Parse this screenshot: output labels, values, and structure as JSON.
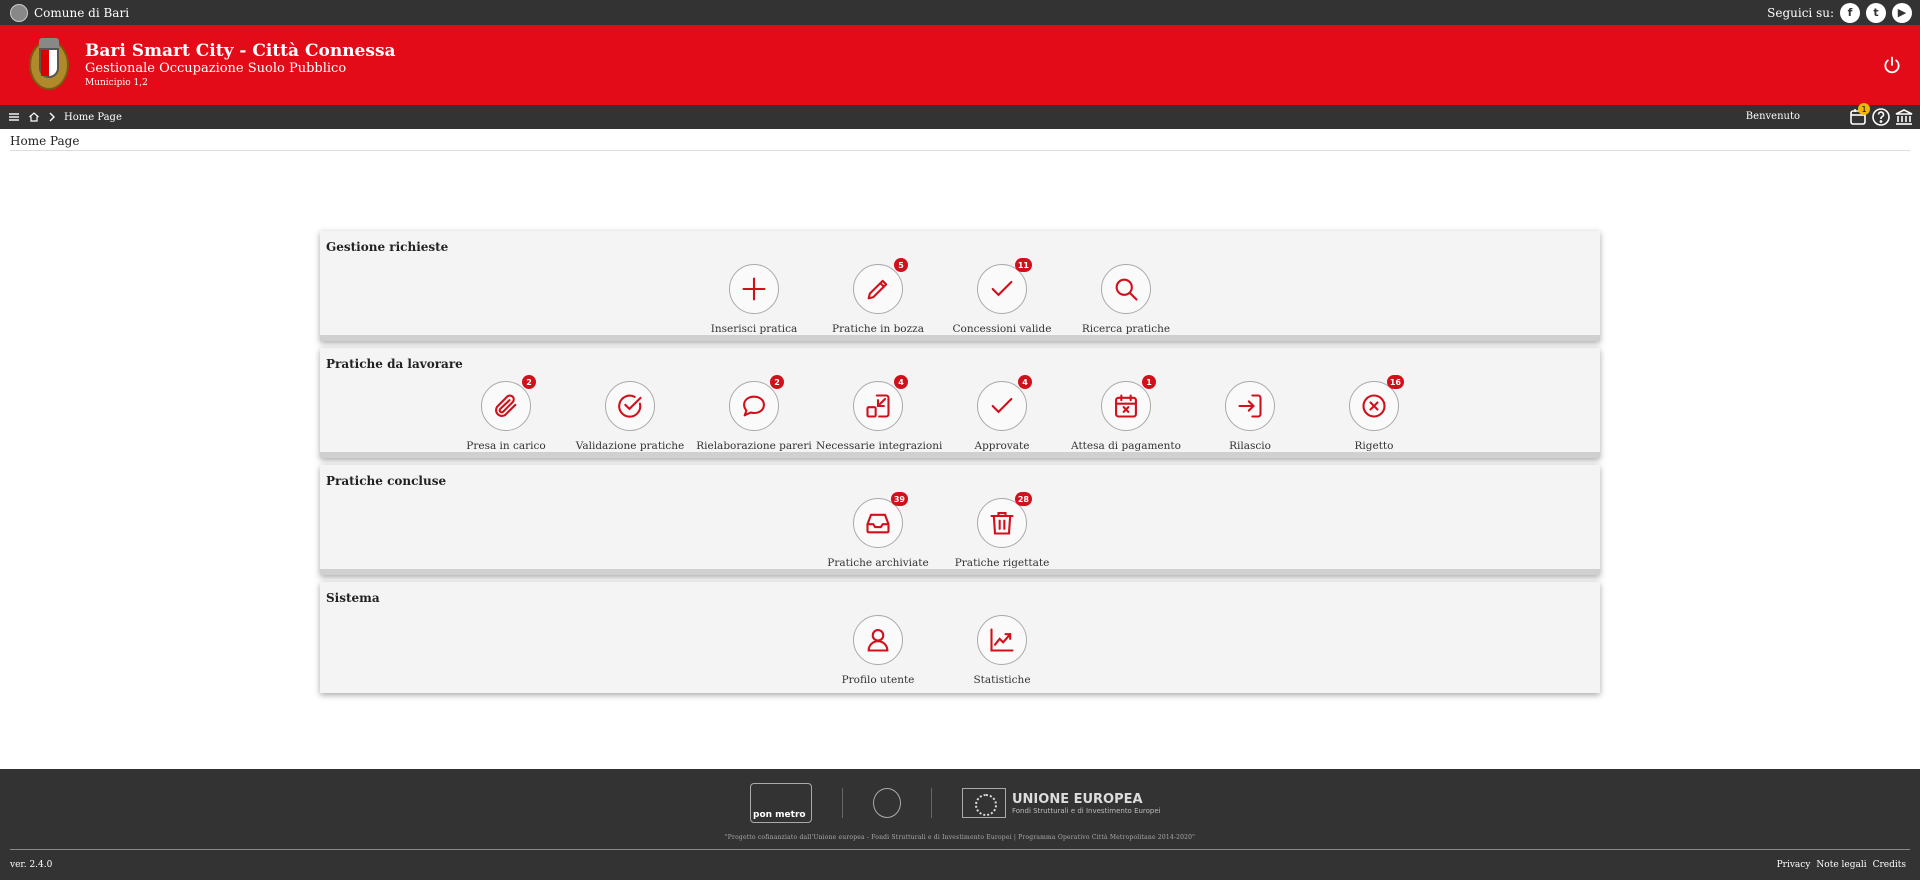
{
  "topbar": {
    "org": "Comune di Bari",
    "follow": "Seguici su:",
    "social": [
      "f",
      "t",
      "▶"
    ]
  },
  "header": {
    "title": "Bari Smart City - Città Connessa",
    "subtitle": "Gestionale Occupazione Suolo Pubblico",
    "subsubtitle": "Municipio 1,2"
  },
  "navbar": {
    "crumb": "Home Page",
    "welcome": "Benvenuto",
    "calendar_badge": "1"
  },
  "page_title": "Home Page",
  "sections": [
    {
      "title": "Gestione richieste",
      "tiles": [
        {
          "label": "Inserisci pratica",
          "badge": ""
        },
        {
          "label": "Pratiche in bozza",
          "badge": "5"
        },
        {
          "label": "Concessioni valide",
          "badge": "11"
        },
        {
          "label": "Ricerca pratiche",
          "badge": ""
        }
      ]
    },
    {
      "title": "Pratiche da lavorare",
      "tiles": [
        {
          "label": "Presa in carico",
          "badge": "2"
        },
        {
          "label": "Validazione pratiche",
          "badge": ""
        },
        {
          "label": "Rielaborazione pareri",
          "badge": "2"
        },
        {
          "label": "Necessarie integrazioni",
          "badge": "4"
        },
        {
          "label": "Approvate",
          "badge": "4"
        },
        {
          "label": "Attesa di pagamento",
          "badge": "1"
        },
        {
          "label": "Rilascio",
          "badge": ""
        },
        {
          "label": "Rigetto",
          "badge": "16"
        }
      ]
    },
    {
      "title": "Pratiche concluse",
      "tiles": [
        {
          "label": "Pratiche archiviate",
          "badge": "39"
        },
        {
          "label": "Pratiche rigettate",
          "badge": "28"
        }
      ]
    },
    {
      "title": "Sistema",
      "tiles": [
        {
          "label": "Profilo utente",
          "badge": ""
        },
        {
          "label": "Statistiche",
          "badge": ""
        }
      ]
    }
  ],
  "footer": {
    "pon": "pon metro",
    "eu_title": "UNIONE EUROPEA",
    "eu_sub": "Fondi Strutturali e di Investimento Europei",
    "note": "\"Progetto cofinanziato dall'Unione europea - Fondi Strutturali e di Investimento Europei | Programma Operativo Città Metropolitane 2014-2020\"",
    "version": "ver. 2.4.0",
    "links": [
      "Privacy",
      "Note legali",
      "Credits"
    ]
  },
  "colors": {
    "accent": "#e30b17",
    "dark": "#333333",
    "badge": "#d0111c"
  }
}
